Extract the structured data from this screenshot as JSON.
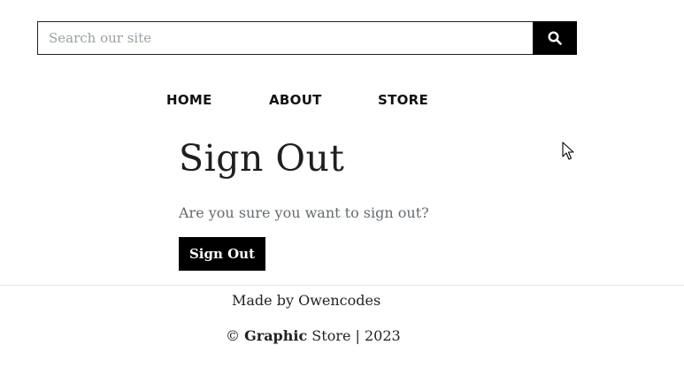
{
  "search": {
    "placeholder": "Search our site",
    "value": "",
    "button_icon": "search-icon"
  },
  "nav": {
    "items": [
      {
        "label": "HOME"
      },
      {
        "label": "ABOUT"
      },
      {
        "label": "STORE"
      }
    ]
  },
  "main": {
    "title": "Sign Out",
    "question": "Are you sure you want to sign out?",
    "button_label": "Sign Out"
  },
  "footer": {
    "made_by": "Made by Owencodes",
    "copyright_symbol": "©",
    "brand_bold": "Graphic",
    "brand_rest": "Store | 2023"
  },
  "colors": {
    "accent": "#000000",
    "muted_text": "#666a70",
    "placeholder": "#9aa0a6",
    "divider": "#e3e3e3"
  }
}
